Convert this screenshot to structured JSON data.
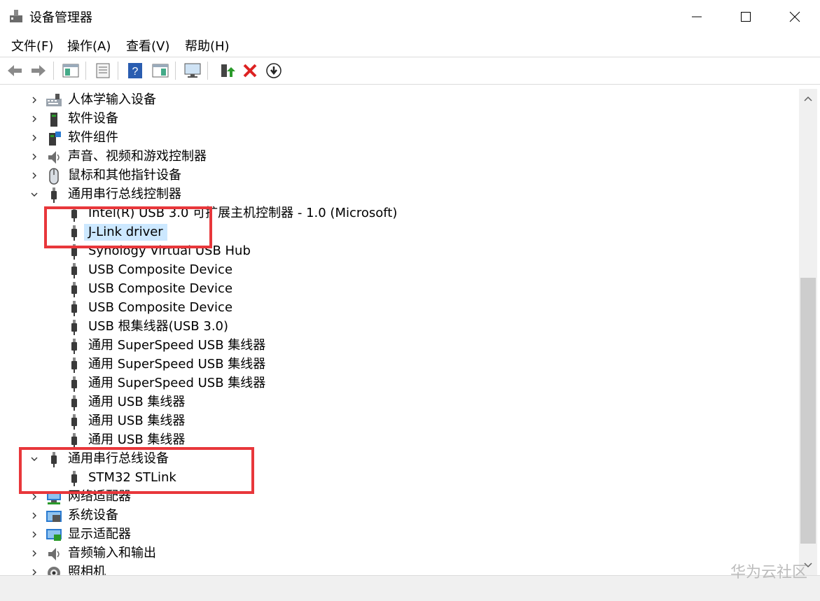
{
  "window": {
    "title": "设备管理器",
    "controls": [
      "minimize-icon",
      "maximize-icon",
      "close-icon"
    ]
  },
  "menu": [
    "文件(F)",
    "操作(A)",
    "查看(V)",
    "帮助(H)"
  ],
  "toolbar": [
    "back-arrow-icon",
    "forward-arrow-icon",
    "show-hide-tree-icon",
    "properties-icon",
    "help-icon",
    "view-icon",
    "scan-hardware-icon",
    "update-driver-icon",
    "uninstall-icon",
    "disable-icon"
  ],
  "tree": [
    {
      "label": "人体学输入设备",
      "level": 0,
      "expanded": false,
      "icon": "hid-icon"
    },
    {
      "label": "软件设备",
      "level": 0,
      "expanded": false,
      "icon": "software-device-icon"
    },
    {
      "label": "软件组件",
      "level": 0,
      "expanded": false,
      "icon": "software-component-icon"
    },
    {
      "label": "声音、视频和游戏控制器",
      "level": 0,
      "expanded": false,
      "icon": "speaker-icon"
    },
    {
      "label": "鼠标和其他指针设备",
      "level": 0,
      "expanded": false,
      "icon": "mouse-icon"
    },
    {
      "label": "通用串行总线控制器",
      "level": 0,
      "expanded": true,
      "icon": "usb-icon"
    },
    {
      "label": "Intel(R) USB 3.0 可扩展主机控制器 - 1.0 (Microsoft)",
      "level": 1,
      "icon": "usb-icon"
    },
    {
      "label": "J-Link driver",
      "level": 1,
      "icon": "usb-icon",
      "selected": true
    },
    {
      "label": "Synology Virtual USB Hub",
      "level": 1,
      "icon": "usb-icon"
    },
    {
      "label": "USB Composite Device",
      "level": 1,
      "icon": "usb-icon"
    },
    {
      "label": "USB Composite Device",
      "level": 1,
      "icon": "usb-icon"
    },
    {
      "label": "USB Composite Device",
      "level": 1,
      "icon": "usb-icon"
    },
    {
      "label": "USB 根集线器(USB 3.0)",
      "level": 1,
      "icon": "usb-icon"
    },
    {
      "label": "通用 SuperSpeed USB 集线器",
      "level": 1,
      "icon": "usb-icon"
    },
    {
      "label": "通用 SuperSpeed USB 集线器",
      "level": 1,
      "icon": "usb-icon"
    },
    {
      "label": "通用 SuperSpeed USB 集线器",
      "level": 1,
      "icon": "usb-icon"
    },
    {
      "label": "通用 USB 集线器",
      "level": 1,
      "icon": "usb-icon"
    },
    {
      "label": "通用 USB 集线器",
      "level": 1,
      "icon": "usb-icon"
    },
    {
      "label": "通用 USB 集线器",
      "level": 1,
      "icon": "usb-icon"
    },
    {
      "label": "通用串行总线设备",
      "level": 0,
      "expanded": true,
      "icon": "usb-icon"
    },
    {
      "label": "STM32 STLink",
      "level": 1,
      "icon": "usb-icon"
    },
    {
      "label": "网络适配器",
      "level": 0,
      "expanded": false,
      "icon": "network-icon"
    },
    {
      "label": "系统设备",
      "level": 0,
      "expanded": false,
      "icon": "system-icon"
    },
    {
      "label": "显示适配器",
      "level": 0,
      "expanded": false,
      "icon": "display-icon"
    },
    {
      "label": "音频输入和输出",
      "level": 0,
      "expanded": false,
      "icon": "audio-icon"
    },
    {
      "label": "照相机",
      "level": 0,
      "expanded": false,
      "icon": "camera-icon"
    }
  ],
  "watermark": "华为云社区",
  "colors": {
    "highlight": "#e8373b",
    "selection": "#cce8ff"
  }
}
